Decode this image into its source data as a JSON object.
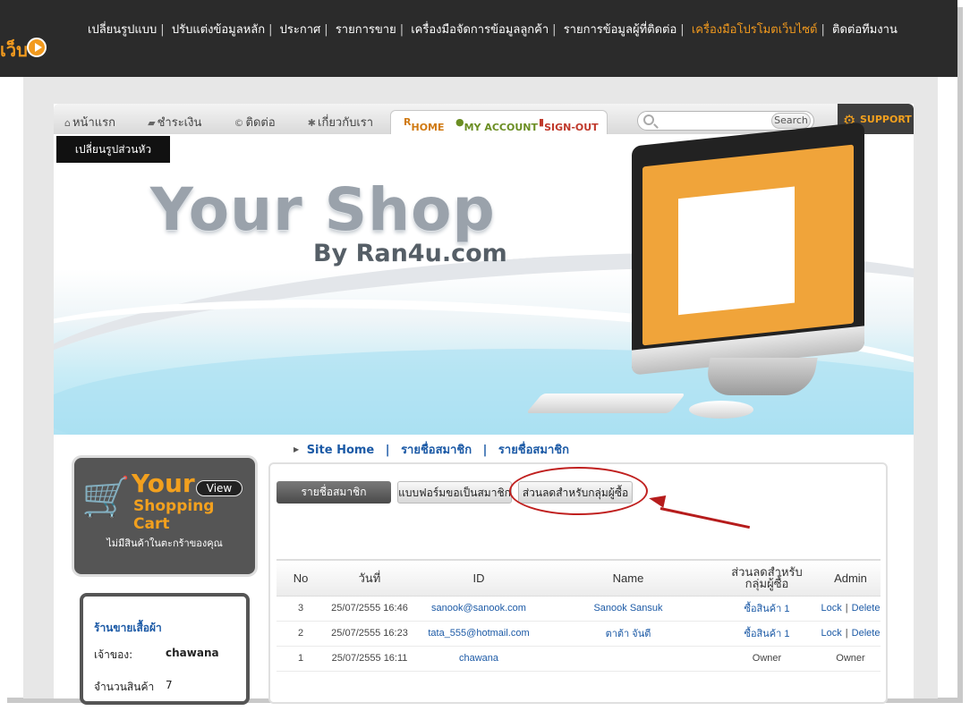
{
  "admin_bar": {
    "logo_fragment": "เว็บ",
    "menu": [
      {
        "label": "เปลี่ยนรูปแบบ",
        "active": false
      },
      {
        "label": "ปรับแต่งข้อมูลหลัก",
        "active": false
      },
      {
        "label": "ประกาศ",
        "active": false
      },
      {
        "label": "รายการขาย",
        "active": false
      },
      {
        "label": "เครื่องมือจัดการข้อมูลลูกค้า",
        "active": false
      },
      {
        "label": "รายการข้อมูลผู้ที่ติดต่อ",
        "active": false
      },
      {
        "label": "เครื่องมือโปรโมตเว็บไซต์",
        "active": true
      },
      {
        "label": "ติดต่อทีมงาน",
        "active": false
      }
    ]
  },
  "site_nav": {
    "links": [
      "หน้าแรก",
      "ชำระเงิน",
      "ติดต่อ",
      "เกี่ยวกับเรา"
    ],
    "account": {
      "home": "HOME",
      "my_account": "MY ACCOUNT",
      "sign_out": "SIGN-OUT"
    },
    "search": {
      "placeholder": "",
      "button": "Search"
    },
    "support": "SUPPORT"
  },
  "banner": {
    "change_header_button": "เปลี่ยนรูปส่วนหัว",
    "title": "Your Shop",
    "subtitle": "By Ran4u.com"
  },
  "breadcrumb": [
    "Site Home",
    "รายชื่อสมาชิก",
    "รายชื่อสมาชิก"
  ],
  "cart": {
    "your": "Your",
    "shopping_cart": "Shopping Cart",
    "view_button": "View",
    "empty_message": "ไม่มีสินค้าในตะกร้าของคุณ"
  },
  "shop_info": {
    "title": "ร้านขายเสื้อผ้า",
    "owner_label": "เจ้าของ:",
    "owner_value": "chawana",
    "products_label": "จำนวนสินค้า",
    "products_value": "7"
  },
  "tabs": {
    "members": "รายชื่อสมาชิก",
    "signup_form": "แบบฟอร์มขอเป็นสมาชิก",
    "group_discount": "ส่วนลดสำหรับกลุ่มผู้ซื้อ"
  },
  "table": {
    "headers": {
      "no": "No",
      "date": "วันที่",
      "id": "ID",
      "name": "Name",
      "discount": "ส่วนลดสำหรับกลุ่มผู้ซื้อ",
      "admin": "Admin"
    },
    "rows": [
      {
        "no": "3",
        "date": "25/07/2555 16:46",
        "id": "sanook@sanook.com",
        "name": "Sanook Sansuk",
        "discount": "ซื้อสินค้า 1",
        "lock": "Lock",
        "sep": "|",
        "delete": "Delete"
      },
      {
        "no": "2",
        "date": "25/07/2555 16:23",
        "id": "tata_555@hotmail.com",
        "name": "ตาต้า จันตี",
        "discount": "ซื้อสินค้า 1",
        "lock": "Lock",
        "sep": "|",
        "delete": "Delete"
      },
      {
        "no": "1",
        "date": "25/07/2555 16:11",
        "id": "chawana",
        "name": "",
        "discount": "Owner",
        "owner_admin": "Owner"
      }
    ]
  },
  "colors": {
    "accent": "#f29a1e",
    "link": "#1c5aa6",
    "callout": "#c0201f",
    "topbar": "#2b2b2b"
  }
}
